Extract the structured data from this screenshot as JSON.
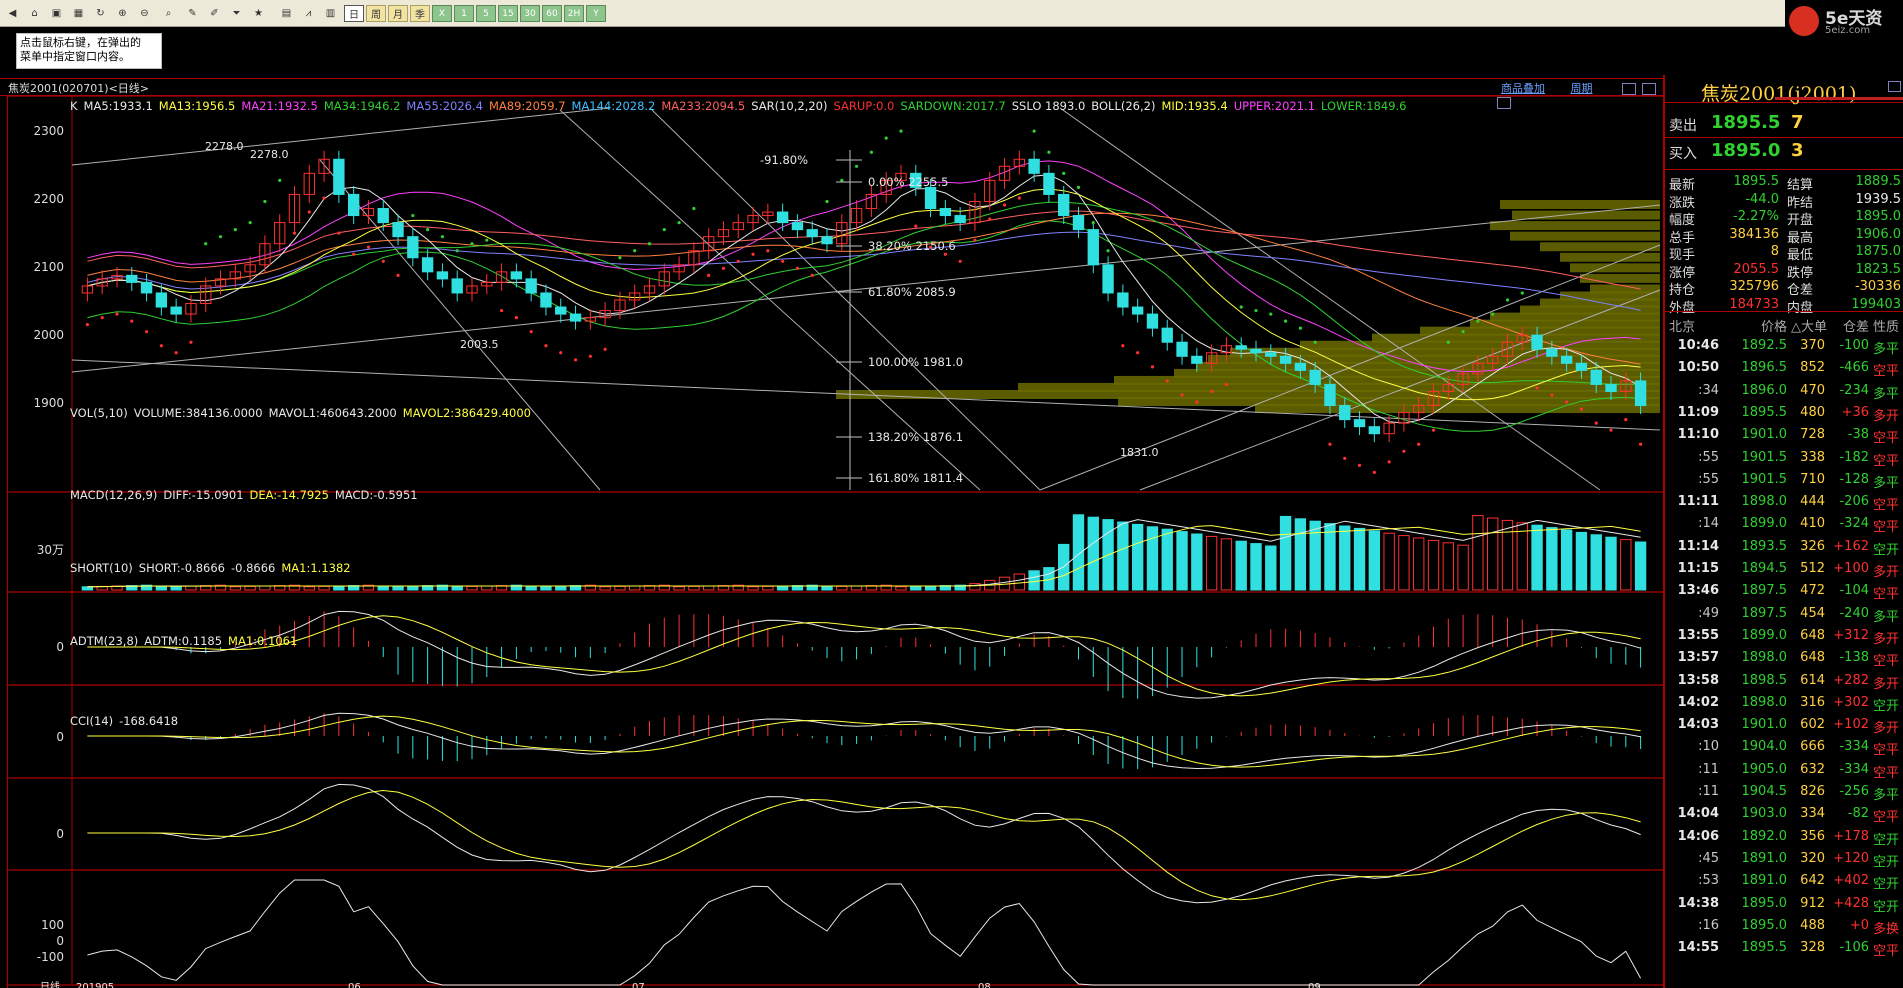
{
  "toolbar": {
    "period_buttons": [
      "日",
      "周",
      "月",
      "季",
      "X",
      "1",
      "5",
      "15",
      "30",
      "60",
      "2H",
      "Y"
    ],
    "active_period": "日"
  },
  "logo": {
    "brand": "5e天资",
    "url": "5eiz.com"
  },
  "hint": {
    "line1": "点击鼠标右键，在弹出的",
    "line2": "菜单中指定窗口内容。"
  },
  "chart": {
    "title": "焦炭2001(020701)<日线>",
    "link_overlay": "商品叠加",
    "link_period": "周期",
    "ma_items": [
      {
        "text": "K",
        "color": "#e8e8e8"
      },
      {
        "text": "MA5:1933.1",
        "color": "#e8e8e8"
      },
      {
        "text": "MA13:1956.5",
        "color": "#ffff40"
      },
      {
        "text": "MA21:1932.5",
        "color": "#ff40ff"
      },
      {
        "text": "MA34:1946.2",
        "color": "#30d030"
      },
      {
        "text": "MA55:2026.4",
        "color": "#8080ff"
      },
      {
        "text": "MA89:2059.7",
        "color": "#ff8040"
      },
      {
        "text": "MA144:2028.2",
        "color": "#40c0ff"
      },
      {
        "text": "MA233:2094.5",
        "color": "#ff6060"
      },
      {
        "text": "SAR(10,2,20)",
        "color": "#e8e8e8"
      },
      {
        "text": "SARUP:0.0",
        "color": "#ff3030"
      },
      {
        "text": "SARDOWN:2017.7",
        "color": "#30d030"
      },
      {
        "text": "SSLO 1893.0",
        "color": "#e8e8e8"
      },
      {
        "text": "BOLL(26,2)",
        "color": "#e8e8e8"
      },
      {
        "text": "MID:1935.4",
        "color": "#ffff40"
      },
      {
        "text": "UPPER:2021.1",
        "color": "#ff40ff"
      },
      {
        "text": "LOWER:1849.6",
        "color": "#30d030"
      }
    ],
    "price_axis": [
      "2300",
      "2200",
      "2100",
      "2000",
      "1900"
    ],
    "price_labels": {
      "high": "2278.0",
      "high2": "2278.0",
      "low1": "2003.5",
      "low2": "1831.0"
    },
    "fib": [
      {
        "pct": "-91.80%",
        "val": ""
      },
      {
        "pct": "0.00%",
        "val": "2255.5"
      },
      {
        "pct": "38.20%",
        "val": "2150.6"
      },
      {
        "pct": "61.80%",
        "val": "2085.9"
      },
      {
        "pct": "100.00%",
        "val": "1981.0"
      },
      {
        "pct": "138.20%",
        "val": "1876.1"
      },
      {
        "pct": "161.80%",
        "val": "1811.4"
      }
    ],
    "vol_label": [
      {
        "text": "VOL(5,10)",
        "color": "#e8e8e8"
      },
      {
        "text": "VOLUME:384136.0000",
        "color": "#e8e8e8"
      },
      {
        "text": "MAVOL1:460643.2000",
        "color": "#e8e8e8"
      },
      {
        "text": "MAVOL2:386429.4000",
        "color": "#ffff40"
      }
    ],
    "vol_axis": "30万",
    "macd_label": [
      {
        "text": "MACD(12,26,9)",
        "color": "#e8e8e8"
      },
      {
        "text": "DIFF:-15.0901",
        "color": "#e8e8e8"
      },
      {
        "text": "DEA:-14.7925",
        "color": "#ffff40"
      },
      {
        "text": "MACD:-0.5951",
        "color": "#e8e8e8"
      }
    ],
    "short_label": [
      {
        "text": "SHORT(10)",
        "color": "#e8e8e8"
      },
      {
        "text": "SHORT:-0.8666",
        "color": "#e8e8e8"
      },
      {
        "text": "-0.8666",
        "color": "#e8e8e8"
      },
      {
        "text": "MA1:1.1382",
        "color": "#ffff40"
      }
    ],
    "adtm_label": [
      {
        "text": "ADTM(23,8)",
        "color": "#e8e8e8"
      },
      {
        "text": "ADTM:0.1185",
        "color": "#e8e8e8"
      },
      {
        "text": "MA1:0.1061",
        "color": "#ffff40"
      }
    ],
    "cci_label": [
      {
        "text": "CCI(14)",
        "color": "#e8e8e8"
      },
      {
        "text": "-168.6418",
        "color": "#e8e8e8"
      }
    ],
    "cci_axis": [
      "100",
      "0",
      "-100"
    ],
    "zero": "0",
    "x_axis": [
      "日线",
      "201905",
      "06",
      "07",
      "08",
      "09"
    ]
  },
  "quote": {
    "title": "焦炭2001(j2001)",
    "sell_label": "卖出",
    "sell_price": "1895.5",
    "sell_vol": "7",
    "buy_label": "买入",
    "buy_price": "1895.0",
    "buy_vol": "3",
    "rows": [
      {
        "l1": "最新",
        "v1": "1895.5",
        "c1": "g",
        "l2": "结算",
        "v2": "1889.5",
        "c2": "g"
      },
      {
        "l1": "涨跌",
        "v1": "-44.0",
        "c1": "g",
        "l2": "昨结",
        "v2": "1939.5",
        "c2": "w"
      },
      {
        "l1": "幅度",
        "v1": "-2.27%",
        "c1": "g",
        "l2": "开盘",
        "v2": "1895.0",
        "c2": "g"
      },
      {
        "l1": "总手",
        "v1": "384136",
        "c1": "y",
        "l2": "最高",
        "v2": "1906.0",
        "c2": "g"
      },
      {
        "l1": "现手",
        "v1": "8",
        "c1": "y",
        "l2": "最低",
        "v2": "1875.0",
        "c2": "g"
      },
      {
        "l1": "涨停",
        "v1": "2055.5",
        "c1": "r",
        "l2": "跌停",
        "v2": "1823.5",
        "c2": "g"
      },
      {
        "l1": "持仓",
        "v1": "325796",
        "c1": "y",
        "l2": "仓差",
        "v2": "-30336",
        "c2": "y"
      },
      {
        "l1": "外盘",
        "v1": "184733",
        "c1": "r",
        "l2": "内盘",
        "v2": "199403",
        "c2": "g"
      }
    ],
    "ticks_header": {
      "loc": "北京",
      "price": "价格",
      "vol": "△大单",
      "diff": "仓差",
      "nature": "性质"
    },
    "ticks": [
      {
        "t": "10:46",
        "p": "1892.5",
        "pc": "g",
        "v": "370",
        "d": "-100",
        "n": "多平",
        "nc": "g"
      },
      {
        "t": "10:50",
        "p": "1896.5",
        "pc": "g",
        "v": "852",
        "d": "-466",
        "n": "空平",
        "nc": "r"
      },
      {
        "t": ":34",
        "p": "1896.0",
        "pc": "g",
        "v": "470",
        "d": "-234",
        "n": "多平",
        "nc": "g"
      },
      {
        "t": "11:09",
        "p": "1895.5",
        "pc": "g",
        "v": "480",
        "d": "+36",
        "n": "多开",
        "nc": "r"
      },
      {
        "t": "11:10",
        "p": "1901.0",
        "pc": "g",
        "v": "728",
        "d": "-38",
        "n": "空平",
        "nc": "r"
      },
      {
        "t": ":55",
        "p": "1901.5",
        "pc": "g",
        "v": "338",
        "d": "-182",
        "n": "空平",
        "nc": "r"
      },
      {
        "t": ":55",
        "p": "1901.5",
        "pc": "g",
        "v": "710",
        "d": "-128",
        "n": "多平",
        "nc": "g"
      },
      {
        "t": "11:11",
        "p": "1898.0",
        "pc": "g",
        "v": "444",
        "d": "-206",
        "n": "空平",
        "nc": "r"
      },
      {
        "t": ":14",
        "p": "1899.0",
        "pc": "g",
        "v": "410",
        "d": "-324",
        "n": "空平",
        "nc": "r"
      },
      {
        "t": "11:14",
        "p": "1893.5",
        "pc": "g",
        "v": "326",
        "d": "+162",
        "n": "空开",
        "nc": "g"
      },
      {
        "t": "11:15",
        "p": "1894.5",
        "pc": "g",
        "v": "512",
        "d": "+100",
        "n": "多开",
        "nc": "r"
      },
      {
        "t": "13:46",
        "p": "1897.5",
        "pc": "g",
        "v": "472",
        "d": "-104",
        "n": "空平",
        "nc": "r"
      },
      {
        "t": ":49",
        "p": "1897.5",
        "pc": "g",
        "v": "454",
        "d": "-240",
        "n": "多平",
        "nc": "g"
      },
      {
        "t": "13:55",
        "p": "1899.0",
        "pc": "g",
        "v": "648",
        "d": "+312",
        "n": "多开",
        "nc": "r"
      },
      {
        "t": "13:57",
        "p": "1898.0",
        "pc": "g",
        "v": "648",
        "d": "-138",
        "n": "空平",
        "nc": "r"
      },
      {
        "t": "13:58",
        "p": "1898.5",
        "pc": "g",
        "v": "614",
        "d": "+282",
        "n": "多开",
        "nc": "r"
      },
      {
        "t": "14:02",
        "p": "1898.0",
        "pc": "g",
        "v": "316",
        "d": "+302",
        "n": "空开",
        "nc": "g"
      },
      {
        "t": "14:03",
        "p": "1901.0",
        "pc": "g",
        "v": "602",
        "d": "+102",
        "n": "多开",
        "nc": "r"
      },
      {
        "t": ":10",
        "p": "1904.0",
        "pc": "g",
        "v": "666",
        "d": "-334",
        "n": "空平",
        "nc": "r"
      },
      {
        "t": ":11",
        "p": "1905.0",
        "pc": "g",
        "v": "632",
        "d": "-334",
        "n": "空平",
        "nc": "r"
      },
      {
        "t": ":11",
        "p": "1904.5",
        "pc": "g",
        "v": "826",
        "d": "-256",
        "n": "多平",
        "nc": "g"
      },
      {
        "t": "14:04",
        "p": "1903.0",
        "pc": "g",
        "v": "334",
        "d": "-82",
        "n": "空平",
        "nc": "r"
      },
      {
        "t": "14:06",
        "p": "1892.0",
        "pc": "g",
        "v": "356",
        "d": "+178",
        "n": "空开",
        "nc": "g"
      },
      {
        "t": ":45",
        "p": "1891.0",
        "pc": "g",
        "v": "320",
        "d": "+120",
        "n": "空开",
        "nc": "g"
      },
      {
        "t": ":53",
        "p": "1891.0",
        "pc": "g",
        "v": "642",
        "d": "+402",
        "n": "空开",
        "nc": "g"
      },
      {
        "t": "14:38",
        "p": "1895.0",
        "pc": "g",
        "v": "912",
        "d": "+428",
        "n": "空开",
        "nc": "g"
      },
      {
        "t": ":16",
        "p": "1895.0",
        "pc": "g",
        "v": "488",
        "d": "+0",
        "n": "多换",
        "nc": "r"
      },
      {
        "t": "14:55",
        "p": "1895.5",
        "pc": "g",
        "v": "328",
        "d": "-106",
        "n": "空平",
        "nc": "r"
      }
    ]
  },
  "chart_data": {
    "type": "candlestick",
    "title": "焦炭2001(020701)<日线>",
    "y_axis_ticks": [
      2300,
      2200,
      2100,
      2000,
      1900
    ],
    "ylim": [
      1780,
      2320
    ],
    "closes": [
      2070,
      2080,
      2085,
      2075,
      2060,
      2040,
      2030,
      2045,
      2070,
      2080,
      2090,
      2100,
      2130,
      2160,
      2200,
      2230,
      2250,
      2200,
      2170,
      2180,
      2160,
      2140,
      2110,
      2090,
      2080,
      2060,
      2070,
      2075,
      2090,
      2080,
      2060,
      2040,
      2030,
      2020,
      2025,
      2035,
      2050,
      2060,
      2070,
      2090,
      2100,
      2120,
      2140,
      2150,
      2160,
      2170,
      2175,
      2160,
      2150,
      2140,
      2130,
      2160,
      2180,
      2200,
      2220,
      2230,
      2210,
      2180,
      2170,
      2160,
      2190,
      2220,
      2240,
      2250,
      2230,
      2200,
      2170,
      2150,
      2100,
      2060,
      2040,
      2030,
      2010,
      1990,
      1970,
      1960,
      1975,
      1985,
      1980,
      1975,
      1970,
      1960,
      1950,
      1930,
      1900,
      1880,
      1870,
      1860,
      1875,
      1890,
      1900,
      1920,
      1930,
      1945,
      1960,
      1970,
      1990,
      2000,
      1980,
      1970,
      1960,
      1950,
      1930,
      1920,
      1935,
      1900
    ]
  }
}
